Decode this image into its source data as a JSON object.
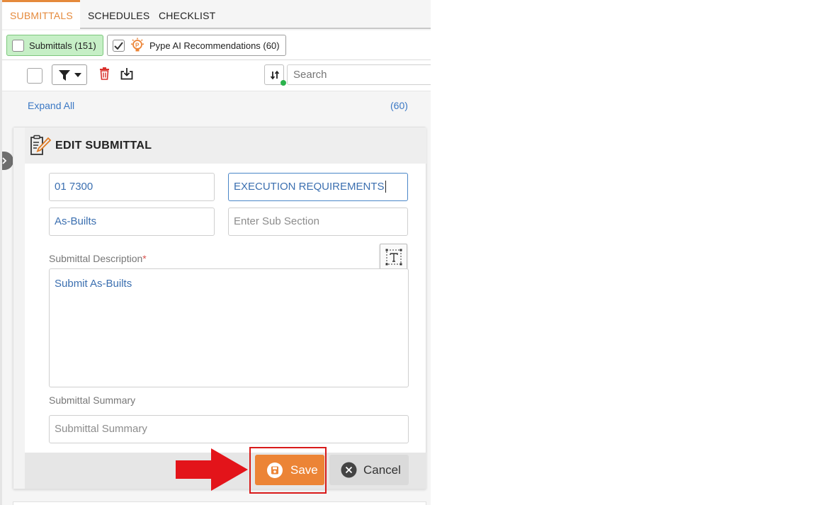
{
  "tabs": [
    {
      "label": "SUBMITTALS",
      "active": true
    },
    {
      "label": "SCHEDULES",
      "active": false
    },
    {
      "label": "CHECKLIST",
      "active": false
    }
  ],
  "filters": {
    "submittals_chip": "Submittals (151)",
    "pype_chip": "Pype AI Recommendations (60)"
  },
  "toolbar": {
    "search_placeholder": "Search"
  },
  "list": {
    "expand_all": "Expand All",
    "count": "(60)"
  },
  "edit": {
    "title": "EDIT SUBMITTAL",
    "spec_number": "01 7300",
    "spec_title": "EXECUTION REQUIREMENTS",
    "section": "As-Builts",
    "sub_section_placeholder": "Enter Sub Section",
    "description_label": "Submittal Description",
    "required_mark": "*",
    "description_value": "Submit As-Builts",
    "summary_label": "Submittal Summary",
    "summary_placeholder": "Submittal Summary",
    "save_label": "Save",
    "cancel_label": "Cancel"
  },
  "colors": {
    "accent": "#e58a3c",
    "save": "#ec8436",
    "link": "#3b78c4",
    "highlight": "#d81a1a"
  }
}
